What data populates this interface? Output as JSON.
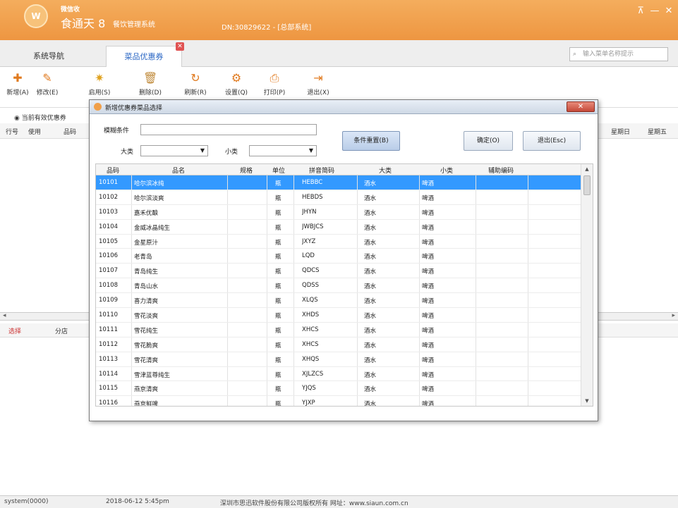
{
  "app": {
    "logo_text": "W",
    "brand_top": "微信收",
    "brand_main": "食通天 8",
    "brand_sub": "餐饮管理系统",
    "title_info": "DN:30829622 - [总部系统]",
    "win_min": "—",
    "win_close": "✕",
    "win_pin": "⊼"
  },
  "nav": {
    "tab1": "系统导航",
    "tab2": "菜品优惠券",
    "tab_close": "✕",
    "search_placeholder": "输入菜单名称提示",
    "search_icon": "⌕"
  },
  "toolbar": {
    "items": [
      {
        "label": "新增(A)",
        "icon": "✚"
      },
      {
        "label": "修改(E)",
        "icon": "✎"
      },
      {
        "label": "启用(S)",
        "icon": "✷"
      },
      {
        "label": "删除(D)",
        "icon": "🗑"
      },
      {
        "label": "刷新(R)",
        "icon": "↻"
      },
      {
        "label": "设置(Q)",
        "icon": "⚙"
      },
      {
        "label": "打印(P)",
        "icon": "⎙"
      },
      {
        "label": "退出(X)",
        "icon": "⇥"
      }
    ]
  },
  "main": {
    "filter_radio": "当前有效优惠券",
    "grid_headers": [
      "行号",
      "使用",
      "品码"
    ],
    "grid_headers_right": [
      "星期日",
      "星期五"
    ],
    "lower_headers": [
      "选择",
      "分店"
    ]
  },
  "dialog": {
    "title": "新增优惠券菜品选择",
    "close_label": "✕",
    "filter_label": "模糊条件",
    "filter_value": "",
    "big_cat_label": "大类",
    "small_cat_label": "小类",
    "select_arrow": "▼",
    "reset_button": "条件重置(B)",
    "confirm_button": "确定(O)",
    "exit_button": "退出(Esc)",
    "columns": [
      "品码",
      "品名",
      "规格",
      "单位",
      "拼音简码",
      "大类",
      "小类",
      "辅助编码"
    ],
    "rows": [
      {
        "code": "10101",
        "name": "哈尔滨冰纯",
        "spec": "",
        "unit": "瓶",
        "py": "HEBBC",
        "big": "酒水",
        "small": "啤酒",
        "aux": ""
      },
      {
        "code": "10102",
        "name": "哈尔滨淡爽",
        "spec": "",
        "unit": "瓶",
        "py": "HEBDS",
        "big": "酒水",
        "small": "啤酒",
        "aux": ""
      },
      {
        "code": "10103",
        "name": "嘉禾优酿",
        "spec": "",
        "unit": "瓶",
        "py": "JHYN",
        "big": "酒水",
        "small": "啤酒",
        "aux": ""
      },
      {
        "code": "10104",
        "name": "金威冰晶纯生",
        "spec": "",
        "unit": "瓶",
        "py": "JWBJCS",
        "big": "酒水",
        "small": "啤酒",
        "aux": ""
      },
      {
        "code": "10105",
        "name": "金星原汁",
        "spec": "",
        "unit": "瓶",
        "py": "JXYZ",
        "big": "酒水",
        "small": "啤酒",
        "aux": ""
      },
      {
        "code": "10106",
        "name": "老青岛",
        "spec": "",
        "unit": "瓶",
        "py": "LQD",
        "big": "酒水",
        "small": "啤酒",
        "aux": ""
      },
      {
        "code": "10107",
        "name": "青岛纯生",
        "spec": "",
        "unit": "瓶",
        "py": "QDCS",
        "big": "酒水",
        "small": "啤酒",
        "aux": ""
      },
      {
        "code": "10108",
        "name": "青岛山水",
        "spec": "",
        "unit": "瓶",
        "py": "QDSS",
        "big": "酒水",
        "small": "啤酒",
        "aux": ""
      },
      {
        "code": "10109",
        "name": "喜力清爽",
        "spec": "",
        "unit": "瓶",
        "py": "XLQS",
        "big": "酒水",
        "small": "啤酒",
        "aux": ""
      },
      {
        "code": "10110",
        "name": "雪花淡爽",
        "spec": "",
        "unit": "瓶",
        "py": "XHDS",
        "big": "酒水",
        "small": "啤酒",
        "aux": ""
      },
      {
        "code": "10111",
        "name": "雪花纯生",
        "spec": "",
        "unit": "瓶",
        "py": "XHCS",
        "big": "酒水",
        "small": "啤酒",
        "aux": ""
      },
      {
        "code": "10112",
        "name": "雪花脆爽",
        "spec": "",
        "unit": "瓶",
        "py": "XHCS",
        "big": "酒水",
        "small": "啤酒",
        "aux": ""
      },
      {
        "code": "10113",
        "name": "雪花清爽",
        "spec": "",
        "unit": "瓶",
        "py": "XHQS",
        "big": "酒水",
        "small": "啤酒",
        "aux": ""
      },
      {
        "code": "10114",
        "name": "雪津蓝尊纯生",
        "spec": "",
        "unit": "瓶",
        "py": "XJLZCS",
        "big": "酒水",
        "small": "啤酒",
        "aux": ""
      },
      {
        "code": "10115",
        "name": "燕京清爽",
        "spec": "",
        "unit": "瓶",
        "py": "YJQS",
        "big": "酒水",
        "small": "啤酒",
        "aux": ""
      },
      {
        "code": "10116",
        "name": "燕京鲜啤",
        "spec": "",
        "unit": "瓶",
        "py": "YJXP",
        "big": "酒水",
        "small": "啤酒",
        "aux": ""
      }
    ],
    "scroll_up": "▲",
    "scroll_down": "▼"
  },
  "status": {
    "user": "system(0000)",
    "datetime": "2018-06-12 5:45pm",
    "copyright": "深圳市思迅软件股份有限公司版权所有 网址：www.siaun.com.cn"
  },
  "colors": {
    "titlebar": "#f0a04b",
    "selected_row": "#3399ff",
    "active_tab_text": "#2a66c4"
  }
}
